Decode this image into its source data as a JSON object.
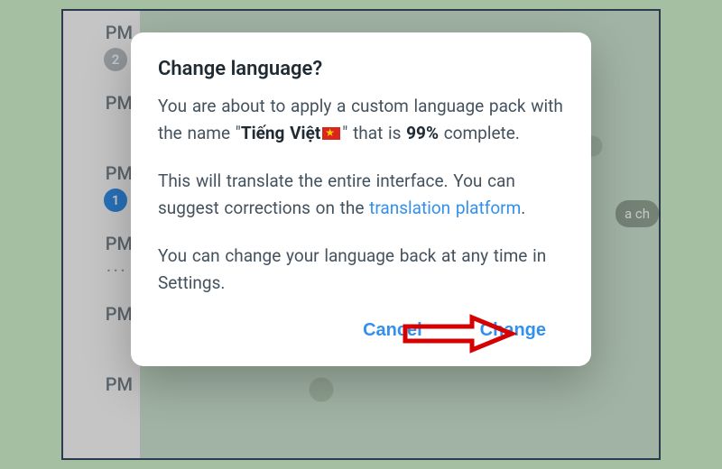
{
  "dialog": {
    "title": "Change language?",
    "body1_a": "You are about to apply a custom language pack with the name \"",
    "body1_name": "Tiếng Việt",
    "body1_b": "\" that is ",
    "body1_pct": "99%",
    "body1_c": " complete.",
    "body2_a": "This will translate the entire interface. You can suggest corrections on the ",
    "body2_link": "translation platform",
    "body2_b": ".",
    "body3": "You can change your language back at any time in Settings.",
    "cancel": "Cancel",
    "change": "Change"
  },
  "sidebar": {
    "time": "PM",
    "badge_gray": "2",
    "badge_blue": "1",
    "dots": "..."
  },
  "chat": {
    "select_hint": "a ch"
  }
}
